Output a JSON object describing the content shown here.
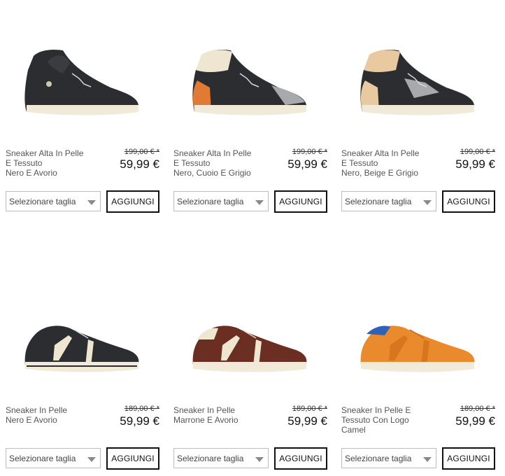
{
  "ui": {
    "size_placeholder": "Selezionare taglia",
    "add_label": "AGGIUNGI"
  },
  "products": [
    {
      "name": [
        "Sneaker Alta In Pelle",
        "E Tessuto",
        "Nero E Avorio"
      ],
      "old_price": "199,00 € *",
      "price": "59,99 €",
      "image": "high-top-sneaker-black"
    },
    {
      "name": [
        "Sneaker Alta In Pelle",
        "E Tessuto",
        "Nero, Cuoio E Grigio"
      ],
      "old_price": "199,00 € *",
      "price": "59,99 €",
      "image": "high-top-sneaker-black-cognac-grey"
    },
    {
      "name": [
        "Sneaker Alta In Pelle",
        "E Tessuto",
        "Nero, Beige E Grigio"
      ],
      "old_price": "199,00 € *",
      "price": "59,99 €",
      "image": "high-top-sneaker-black-beige-grey"
    },
    {
      "name": [
        "Sneaker In Pelle",
        "Nero E Avorio"
      ],
      "old_price": "189,00 € *",
      "price": "59,99 €",
      "image": "low-sneaker-black"
    },
    {
      "name": [
        "Sneaker In Pelle",
        "Marrone E Avorio"
      ],
      "old_price": "189,00 € *",
      "price": "59,99 €",
      "image": "low-sneaker-brown"
    },
    {
      "name": [
        "Sneaker In Pelle E",
        "Tessuto Con Logo",
        "Camel"
      ],
      "old_price": "189,00 € *",
      "price": "59,99 €",
      "image": "low-sneaker-camel"
    }
  ],
  "colors": {
    "black_shoe": "#2b2d31",
    "cognac": "#e07a34",
    "beige": "#e9c9a0",
    "grey": "#a7a9ac",
    "brown": "#6b2e23",
    "camel": "#e98a2c",
    "ivory": "#efe6d2",
    "sole": "#f1ead9"
  }
}
